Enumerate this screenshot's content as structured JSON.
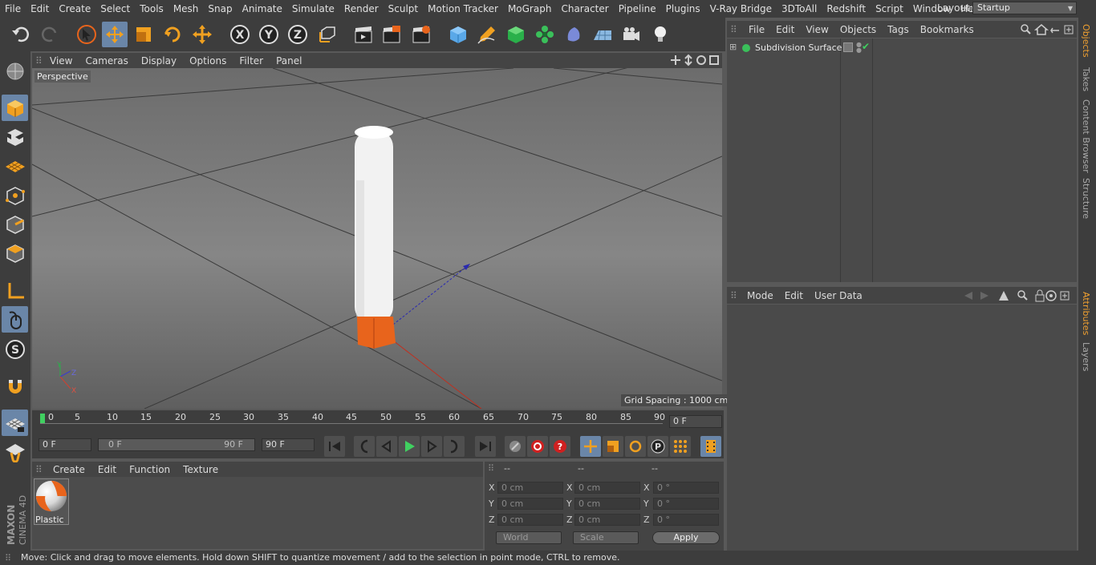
{
  "menubar": {
    "items": [
      "File",
      "Edit",
      "Create",
      "Select",
      "Tools",
      "Mesh",
      "Snap",
      "Animate",
      "Simulate",
      "Render",
      "Sculpt",
      "Motion Tracker",
      "MoGraph",
      "Character",
      "Pipeline",
      "Plugins",
      "V-Ray Bridge",
      "3DToAll",
      "Redshift",
      "Script",
      "Window",
      "Help"
    ],
    "layout_label": "Layout:",
    "layout_value": "Startup"
  },
  "viewport": {
    "menu": [
      "View",
      "Cameras",
      "Display",
      "Options",
      "Filter",
      "Panel"
    ],
    "camera_label": "Perspective",
    "grid_spacing": "Grid Spacing : 1000 cm",
    "axis_labels": {
      "y": "Y",
      "z": "Z",
      "x": "X"
    }
  },
  "timeline": {
    "ticks": [
      "0",
      "5",
      "10",
      "15",
      "20",
      "25",
      "30",
      "35",
      "40",
      "45",
      "50",
      "55",
      "60",
      "65",
      "70",
      "75",
      "80",
      "85",
      "90"
    ],
    "current_frame": "0 F",
    "start_frame": "0 F",
    "range_start": "0 F",
    "range_end": "90 F",
    "end_frame": "90 F"
  },
  "material_manager": {
    "menu": [
      "Create",
      "Edit",
      "Function",
      "Texture"
    ],
    "materials": [
      {
        "name": "Plastic"
      }
    ]
  },
  "coordinates": {
    "headers": [
      "--",
      "--",
      "--"
    ],
    "rows": [
      {
        "axis": "X",
        "pos": "0 cm",
        "size_axis": "X",
        "size": "0 cm",
        "rot_axis": "X",
        "rot": "0 °"
      },
      {
        "axis": "Y",
        "pos": "0 cm",
        "size_axis": "Y",
        "size": "0 cm",
        "rot_axis": "Y",
        "rot": "0 °"
      },
      {
        "axis": "Z",
        "pos": "0 cm",
        "size_axis": "Z",
        "size": "0 cm",
        "rot_axis": "Z",
        "rot": "0 °"
      }
    ],
    "world": "World",
    "scale": "Scale",
    "apply": "Apply"
  },
  "object_manager": {
    "menu": [
      "File",
      "Edit",
      "View",
      "Objects",
      "Tags",
      "Bookmarks"
    ],
    "objects": [
      {
        "name": "Subdivision Surface"
      }
    ]
  },
  "attribute_manager": {
    "menu": [
      "Mode",
      "Edit",
      "User Data"
    ]
  },
  "side_tabs": [
    "Objects",
    "Takes",
    "Content Browser",
    "Structure",
    "Attributes",
    "Layers"
  ],
  "status": "Move: Click and drag to move elements. Hold down SHIFT to quantize movement / add to the selection in point mode, CTRL to remove.",
  "brand": {
    "line1": "MAXON",
    "line2": "CINEMA 4D"
  },
  "colors": {
    "accent": "#6a86a8",
    "orange": "#e8641c",
    "panel": "#3d3d3d"
  }
}
